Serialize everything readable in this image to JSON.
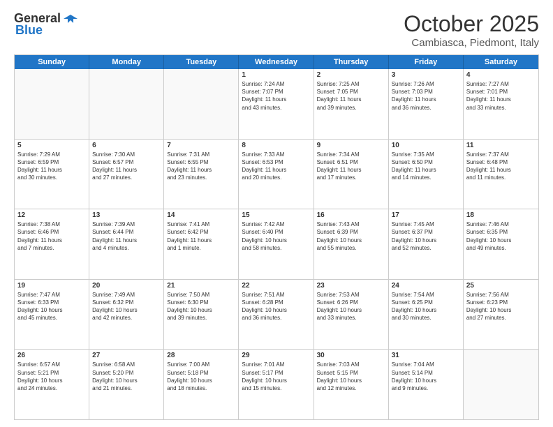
{
  "header": {
    "logo_general": "General",
    "logo_blue": "Blue",
    "month_title": "October 2025",
    "subtitle": "Cambiasca, Piedmont, Italy"
  },
  "day_headers": [
    "Sunday",
    "Monday",
    "Tuesday",
    "Wednesday",
    "Thursday",
    "Friday",
    "Saturday"
  ],
  "weeks": [
    [
      {
        "day": "",
        "info": ""
      },
      {
        "day": "",
        "info": ""
      },
      {
        "day": "",
        "info": ""
      },
      {
        "day": "1",
        "info": "Sunrise: 7:24 AM\nSunset: 7:07 PM\nDaylight: 11 hours\nand 43 minutes."
      },
      {
        "day": "2",
        "info": "Sunrise: 7:25 AM\nSunset: 7:05 PM\nDaylight: 11 hours\nand 39 minutes."
      },
      {
        "day": "3",
        "info": "Sunrise: 7:26 AM\nSunset: 7:03 PM\nDaylight: 11 hours\nand 36 minutes."
      },
      {
        "day": "4",
        "info": "Sunrise: 7:27 AM\nSunset: 7:01 PM\nDaylight: 11 hours\nand 33 minutes."
      }
    ],
    [
      {
        "day": "5",
        "info": "Sunrise: 7:29 AM\nSunset: 6:59 PM\nDaylight: 11 hours\nand 30 minutes."
      },
      {
        "day": "6",
        "info": "Sunrise: 7:30 AM\nSunset: 6:57 PM\nDaylight: 11 hours\nand 27 minutes."
      },
      {
        "day": "7",
        "info": "Sunrise: 7:31 AM\nSunset: 6:55 PM\nDaylight: 11 hours\nand 23 minutes."
      },
      {
        "day": "8",
        "info": "Sunrise: 7:33 AM\nSunset: 6:53 PM\nDaylight: 11 hours\nand 20 minutes."
      },
      {
        "day": "9",
        "info": "Sunrise: 7:34 AM\nSunset: 6:51 PM\nDaylight: 11 hours\nand 17 minutes."
      },
      {
        "day": "10",
        "info": "Sunrise: 7:35 AM\nSunset: 6:50 PM\nDaylight: 11 hours\nand 14 minutes."
      },
      {
        "day": "11",
        "info": "Sunrise: 7:37 AM\nSunset: 6:48 PM\nDaylight: 11 hours\nand 11 minutes."
      }
    ],
    [
      {
        "day": "12",
        "info": "Sunrise: 7:38 AM\nSunset: 6:46 PM\nDaylight: 11 hours\nand 7 minutes."
      },
      {
        "day": "13",
        "info": "Sunrise: 7:39 AM\nSunset: 6:44 PM\nDaylight: 11 hours\nand 4 minutes."
      },
      {
        "day": "14",
        "info": "Sunrise: 7:41 AM\nSunset: 6:42 PM\nDaylight: 11 hours\nand 1 minute."
      },
      {
        "day": "15",
        "info": "Sunrise: 7:42 AM\nSunset: 6:40 PM\nDaylight: 10 hours\nand 58 minutes."
      },
      {
        "day": "16",
        "info": "Sunrise: 7:43 AM\nSunset: 6:39 PM\nDaylight: 10 hours\nand 55 minutes."
      },
      {
        "day": "17",
        "info": "Sunrise: 7:45 AM\nSunset: 6:37 PM\nDaylight: 10 hours\nand 52 minutes."
      },
      {
        "day": "18",
        "info": "Sunrise: 7:46 AM\nSunset: 6:35 PM\nDaylight: 10 hours\nand 49 minutes."
      }
    ],
    [
      {
        "day": "19",
        "info": "Sunrise: 7:47 AM\nSunset: 6:33 PM\nDaylight: 10 hours\nand 45 minutes."
      },
      {
        "day": "20",
        "info": "Sunrise: 7:49 AM\nSunset: 6:32 PM\nDaylight: 10 hours\nand 42 minutes."
      },
      {
        "day": "21",
        "info": "Sunrise: 7:50 AM\nSunset: 6:30 PM\nDaylight: 10 hours\nand 39 minutes."
      },
      {
        "day": "22",
        "info": "Sunrise: 7:51 AM\nSunset: 6:28 PM\nDaylight: 10 hours\nand 36 minutes."
      },
      {
        "day": "23",
        "info": "Sunrise: 7:53 AM\nSunset: 6:26 PM\nDaylight: 10 hours\nand 33 minutes."
      },
      {
        "day": "24",
        "info": "Sunrise: 7:54 AM\nSunset: 6:25 PM\nDaylight: 10 hours\nand 30 minutes."
      },
      {
        "day": "25",
        "info": "Sunrise: 7:56 AM\nSunset: 6:23 PM\nDaylight: 10 hours\nand 27 minutes."
      }
    ],
    [
      {
        "day": "26",
        "info": "Sunrise: 6:57 AM\nSunset: 5:21 PM\nDaylight: 10 hours\nand 24 minutes."
      },
      {
        "day": "27",
        "info": "Sunrise: 6:58 AM\nSunset: 5:20 PM\nDaylight: 10 hours\nand 21 minutes."
      },
      {
        "day": "28",
        "info": "Sunrise: 7:00 AM\nSunset: 5:18 PM\nDaylight: 10 hours\nand 18 minutes."
      },
      {
        "day": "29",
        "info": "Sunrise: 7:01 AM\nSunset: 5:17 PM\nDaylight: 10 hours\nand 15 minutes."
      },
      {
        "day": "30",
        "info": "Sunrise: 7:03 AM\nSunset: 5:15 PM\nDaylight: 10 hours\nand 12 minutes."
      },
      {
        "day": "31",
        "info": "Sunrise: 7:04 AM\nSunset: 5:14 PM\nDaylight: 10 hours\nand 9 minutes."
      },
      {
        "day": "",
        "info": ""
      }
    ]
  ]
}
